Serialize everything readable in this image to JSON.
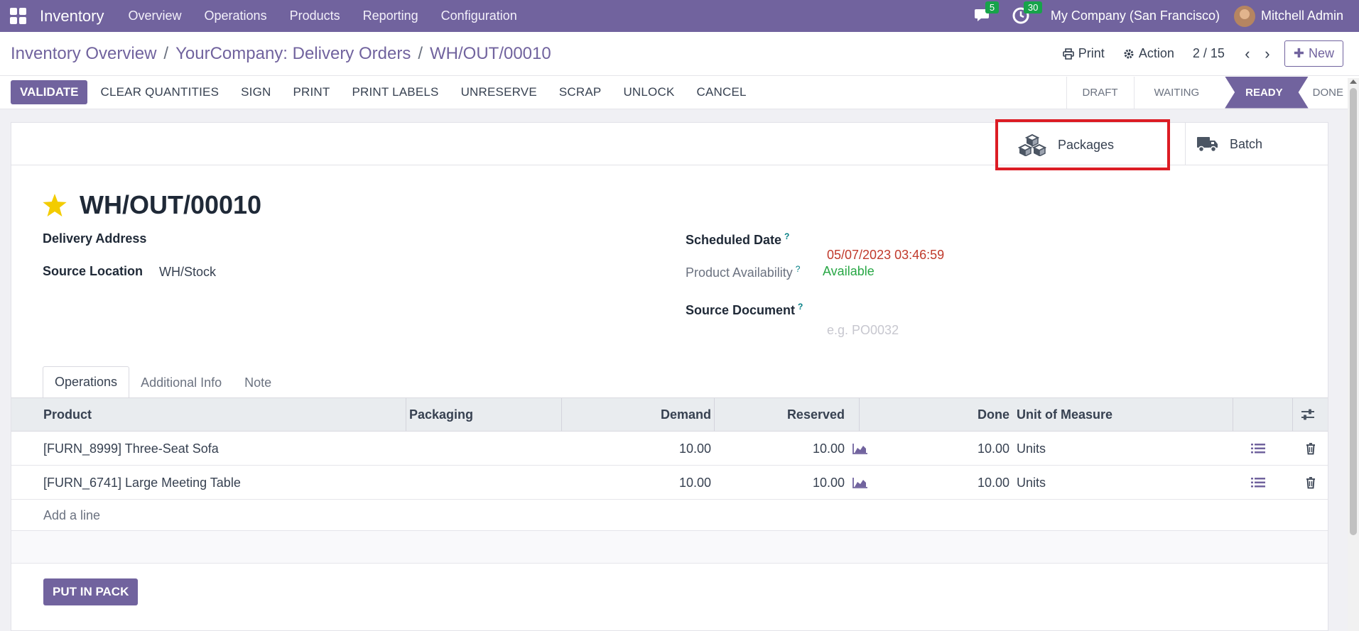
{
  "navbar": {
    "app_name": "Inventory",
    "menu": [
      "Overview",
      "Operations",
      "Products",
      "Reporting",
      "Configuration"
    ],
    "messages_count": "5",
    "activities_count": "30",
    "company": "My Company (San Francisco)",
    "user": "Mitchell Admin"
  },
  "breadcrumb": {
    "level1": "Inventory Overview",
    "level2": "YourCompany: Delivery Orders",
    "current": "WH/OUT/00010",
    "sep": "/"
  },
  "control": {
    "print_label": "Print",
    "action_label": "Action",
    "pager": "2 / 15",
    "new_label": "New"
  },
  "actions": {
    "validate": "VALIDATE",
    "buttons": [
      "CLEAR QUANTITIES",
      "SIGN",
      "PRINT",
      "PRINT LABELS",
      "UNRESERVE",
      "SCRAP",
      "UNLOCK",
      "CANCEL"
    ]
  },
  "statusbar": [
    "DRAFT",
    "WAITING",
    "READY",
    "DONE"
  ],
  "active_status": "READY",
  "smart_buttons": {
    "packages": "Packages",
    "batch": "Batch"
  },
  "record": {
    "title": "WH/OUT/00010",
    "delivery_address_label": "Delivery Address",
    "source_location_label": "Source Location",
    "source_location": "WH/Stock",
    "scheduled_date_label": "Scheduled Date",
    "scheduled_date": "05/07/2023 03:46:59",
    "availability_label": "Product Availability",
    "availability": "Available",
    "source_document_label": "Source Document",
    "source_document_placeholder": "e.g. PO0032",
    "help_mark": "?"
  },
  "tabs": [
    "Operations",
    "Additional Info",
    "Note"
  ],
  "table": {
    "headers": {
      "product": "Product",
      "packaging": "Packaging",
      "demand": "Demand",
      "reserved": "Reserved",
      "done": "Done",
      "uom": "Unit of Measure"
    },
    "rows": [
      {
        "product": "[FURN_8999] Three-Seat Sofa",
        "demand": "10.00",
        "reserved": "10.00",
        "done": "10.00",
        "uom": "Units"
      },
      {
        "product": "[FURN_6741] Large Meeting Table",
        "demand": "10.00",
        "reserved": "10.00",
        "done": "10.00",
        "uom": "Units"
      }
    ],
    "add_line": "Add a line"
  },
  "put_in_pack": "PUT IN PACK",
  "colors": {
    "brand": "#71639e",
    "highlight": "#dc1c24",
    "date": "#c0392b",
    "available": "#28a745"
  }
}
